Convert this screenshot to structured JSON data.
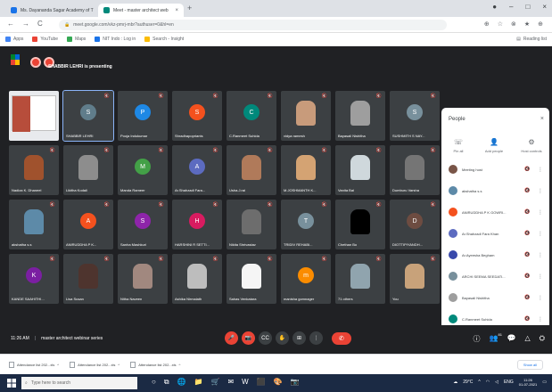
{
  "browser": {
    "tabs": [
      {
        "label": "Ms. Dayananda Sagar Academy of T",
        "close": "×",
        "color": "#1a73e8"
      },
      {
        "label": "Meet - master architect web",
        "close": "×",
        "color": "#00897b"
      }
    ],
    "new_tab": "+",
    "window_controls": [
      "●",
      "–",
      "□",
      "×"
    ],
    "nav": [
      "←",
      "→",
      "C"
    ],
    "url": "meet.google.com/vkz-pmrj-mbr?authuser=0&hl=en",
    "toolbar_icons": [
      "⊕",
      "☆",
      "⊗",
      "★",
      "⊕"
    ],
    "bookmarks": [
      {
        "label": "Apps",
        "color": "#4285f4"
      },
      {
        "label": "YouTube",
        "color": "#ea4335"
      },
      {
        "label": "Maps",
        "color": "#34a853"
      },
      {
        "label": "NIT Indo : Log in",
        "color": "#1a73e8"
      },
      {
        "label": "Search - Insight",
        "color": "#fbbc04"
      }
    ],
    "reading_list": "Reading list"
  },
  "meet": {
    "presenting_text": "SHABBIR LEHRI is presenting",
    "tiles": [
      {
        "name": "",
        "kind": "screen"
      },
      {
        "name": "SHABBIR LEHRI",
        "initial": "S",
        "color": "#607d8b",
        "selected": true
      },
      {
        "name": "Pooja Indukumar",
        "initial": "P",
        "color": "#1e88e5"
      },
      {
        "name": "Shradhapopriants",
        "initial": "S",
        "color": "#f4511e"
      },
      {
        "name": "C.Ranmeet Suhida",
        "initial": "C",
        "color": "#00897b"
      },
      {
        "name": "vidya ramesh",
        "kind": "photo",
        "color": "#c89b7b"
      },
      {
        "name": "Bayasali Nishitha",
        "kind": "photo",
        "color": "#9e9e9e"
      },
      {
        "name": "SUSHMITH S NAY...",
        "initial": "S",
        "color": "#78909c"
      },
      {
        "name": "Nadiza K. Dhaneel",
        "kind": "photo",
        "color": "#a0522d"
      },
      {
        "name": "Likitha Kodali",
        "kind": "photo",
        "color": "#8d8d8d"
      },
      {
        "name": "Manda Rameer",
        "initial": "M",
        "color": "#43a047"
      },
      {
        "name": "Ar.Shahzadi Fara...",
        "initial": "A",
        "color": "#5c6bc0"
      },
      {
        "name": "Usha.J.rai",
        "kind": "photo",
        "color": "#b07a5a"
      },
      {
        "name": "M.JOSHMANTH K...",
        "kind": "photo",
        "color": "#d4a373"
      },
      {
        "name": "Vanita Bai",
        "kind": "photo",
        "color": "#cfd8dc"
      },
      {
        "name": "Dumburu Varsha",
        "kind": "photo",
        "color": "#757575"
      },
      {
        "name": "akshatha s.s",
        "kind": "photo",
        "color": "#5d8aa8"
      },
      {
        "name": "ANIRUDDHA P K...",
        "initial": "A",
        "color": "#f4511e"
      },
      {
        "name": "Sanha Mashkuri",
        "initial": "S",
        "color": "#8e24aa"
      },
      {
        "name": "HARSHINI R SETTI...",
        "initial": "H",
        "color": "#d81b60"
      },
      {
        "name": "Nikita Shrivastav",
        "kind": "photo",
        "color": "#6d6d6d"
      },
      {
        "name": "TRIDIV REHABI...",
        "initial": "T",
        "color": "#78909c"
      },
      {
        "name": "Chethan Bo",
        "kind": "photo",
        "color": "#000000"
      },
      {
        "name": "DIOTTIPIYANDH...",
        "initial": "D",
        "color": "#6d4c41"
      },
      {
        "name": "KANDE SAAHITHI...",
        "initial": "K",
        "color": "#7b1fa2"
      },
      {
        "name": "Lisa Susan",
        "kind": "photo",
        "color": "#4e342e"
      },
      {
        "name": "Nitha Naveen",
        "kind": "photo",
        "color": "#a1887f"
      },
      {
        "name": "Ashika Nirmalath",
        "kind": "photo",
        "color": "#bdbdbd"
      },
      {
        "name": "Sahas Venkatara",
        "kind": "photo",
        "color": "#f5f5f5"
      },
      {
        "name": "manisha gomnager",
        "initial": "m",
        "color": "#fb8c00"
      },
      {
        "name": "71 others",
        "kind": "others",
        "color": "#90a4ae"
      },
      {
        "name": "You",
        "kind": "photo",
        "color": "#c8a27a"
      }
    ],
    "time": "11:26 AM",
    "separator": "|",
    "meeting_title": "master architect webinar series",
    "controls": [
      "🎤",
      "📷",
      "CC",
      "✋",
      "⊞",
      "⋮"
    ],
    "hangup": "✆",
    "participant_count": "81",
    "right_icons": [
      "ⓘ",
      "👥",
      "💬",
      "△",
      "⛭"
    ]
  },
  "people": {
    "title": "People",
    "close": "×",
    "tabs": [
      {
        "icon": "☏",
        "label": "Pin all"
      },
      {
        "icon": "👤",
        "label": "Add people"
      },
      {
        "icon": "⚙",
        "label": "Host controls"
      }
    ],
    "participants": [
      {
        "name": "Meeting host",
        "color": "#795548"
      },
      {
        "name": "akshatha s.s",
        "color": "#5d8aa8"
      },
      {
        "name": "ANIRUDDHA P K GOWRI...",
        "color": "#f4511e"
      },
      {
        "name": "Ar.Shahzadi Fara Khan",
        "color": "#5c6bc0"
      },
      {
        "name": "Ar.Ayeesha Begham",
        "color": "#3949ab"
      },
      {
        "name": "ARCHI SEEMA SEEDATI...",
        "color": "#78909c"
      },
      {
        "name": "Bayasali Nishitha",
        "color": "#9e9e9e"
      },
      {
        "name": "C.Ranmeet Suhida",
        "color": "#00897b"
      },
      {
        "name": "Chethan Bo",
        "color": "#000000"
      }
    ],
    "mic_glyph": "🔇",
    "more_glyph": "⋮"
  },
  "downloads": {
    "items": [
      "Attendance list 202...xls",
      "Attendance list 202...xls",
      "Attendance list 202...xls"
    ],
    "chevron": "^",
    "show_all": "Show all"
  },
  "taskbar": {
    "search_placeholder": "Type here to search",
    "app_icons": [
      "○",
      "⧉",
      "🌐",
      "📁",
      "🛒",
      "✉",
      "W",
      "⬛",
      "🎨",
      "📷"
    ],
    "weather": "29°C",
    "clock_time": "11:26",
    "clock_date": "01-07-2021",
    "lang": "ENG"
  }
}
